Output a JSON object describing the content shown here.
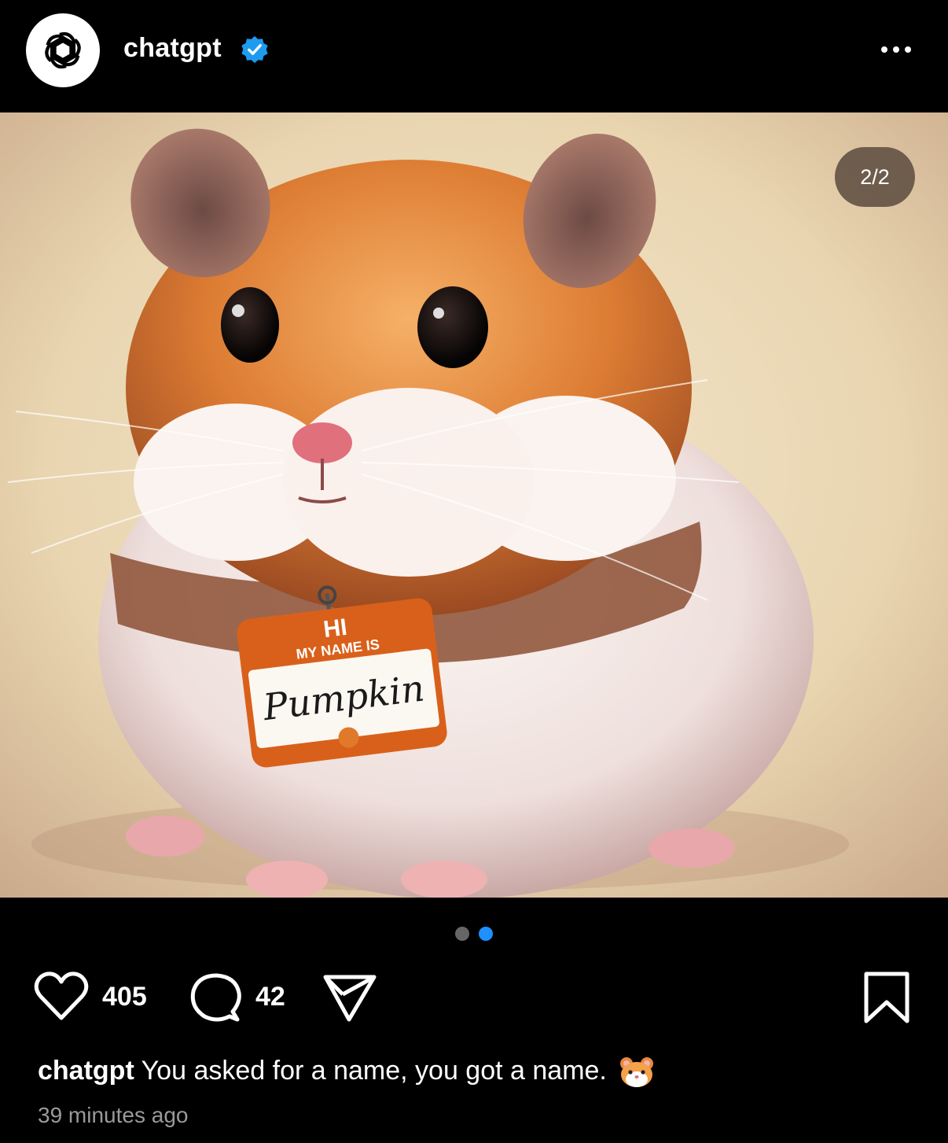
{
  "post": {
    "username": "chatgpt",
    "verified": true,
    "more_icon": "more-dots-icon",
    "avatar_icon": "openai-logo-icon"
  },
  "media": {
    "counter": "2/2",
    "current_index": 2,
    "total": 2,
    "tag_line1": "HI",
    "tag_line2": "MY NAME IS",
    "tag_name": "Pumpkin"
  },
  "actions": {
    "likes": "405",
    "comments": "42",
    "like_icon": "heart-icon",
    "comment_icon": "comment-icon",
    "share_icon": "send-icon",
    "save_icon": "bookmark-icon"
  },
  "caption": {
    "username": "chatgpt",
    "text": "You asked for a name, you got a name.",
    "emoji_icon": "hamster-emoji-icon"
  },
  "timestamp": "39 minutes ago",
  "colors": {
    "background": "#000000",
    "active_dot": "#1e90ff",
    "inactive_dot": "#666666",
    "verified_badge": "#1d9bf0"
  }
}
